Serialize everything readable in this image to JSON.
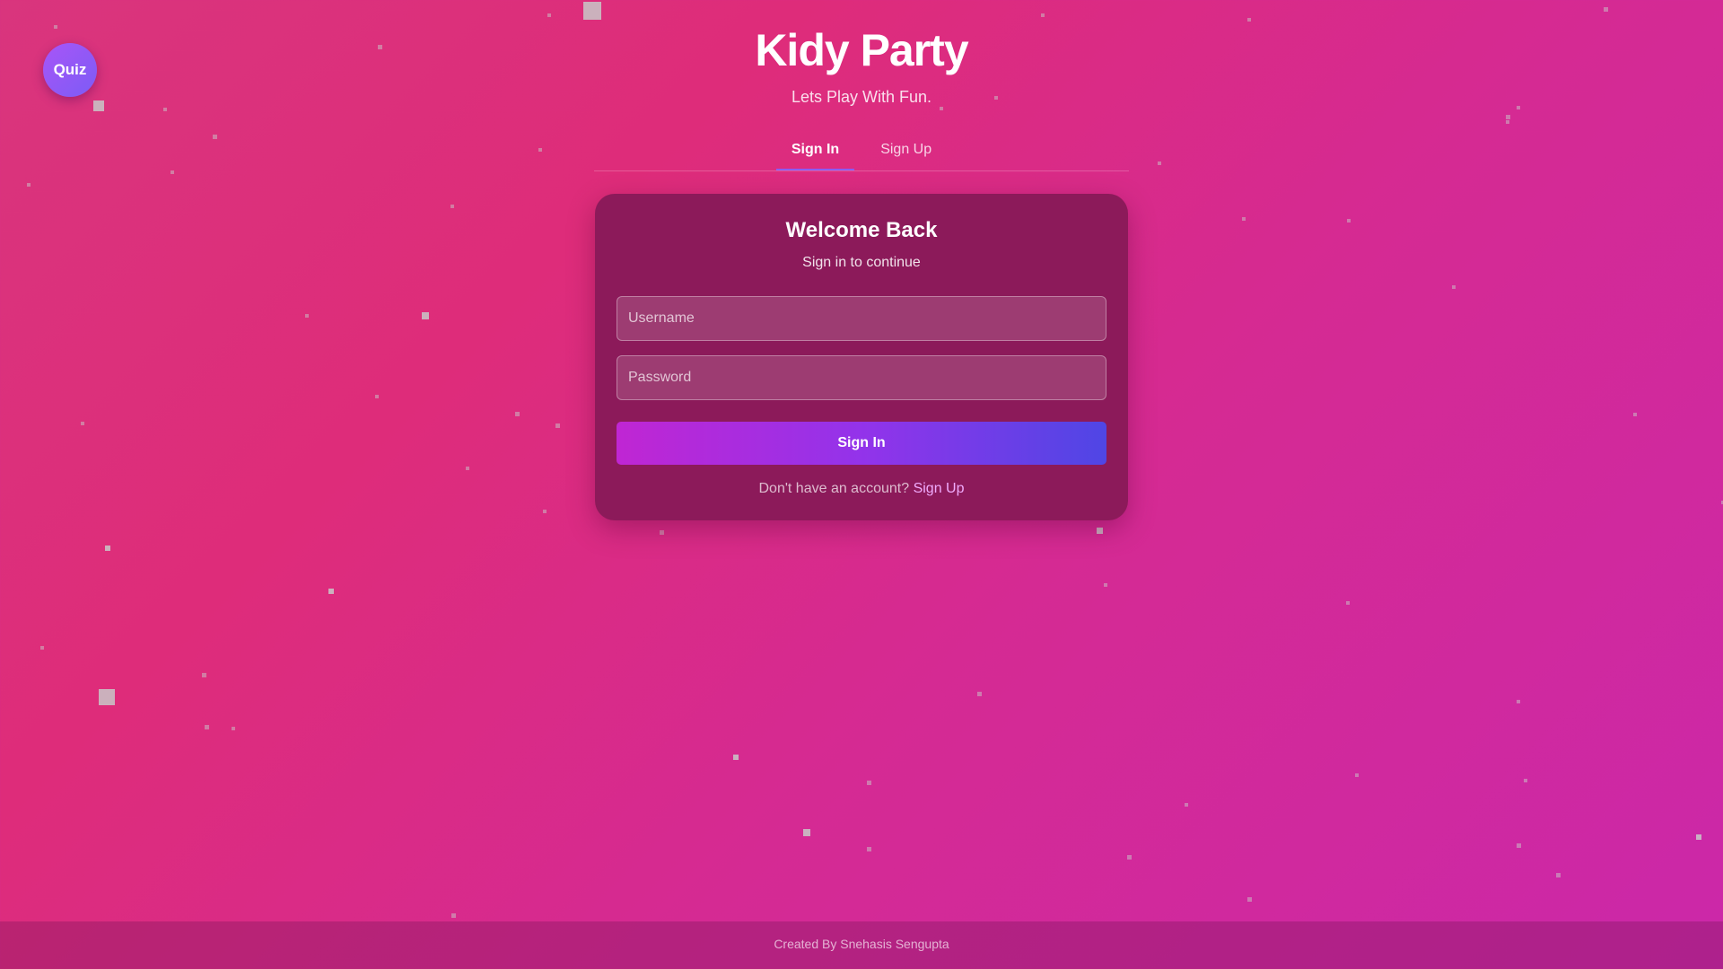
{
  "quiz_button": {
    "label": "Quiz"
  },
  "header": {
    "title": "Kidy Party",
    "subtitle": "Lets Play With Fun."
  },
  "tabs": [
    {
      "label": "Sign In",
      "active": true
    },
    {
      "label": "Sign Up",
      "active": false
    }
  ],
  "form": {
    "title": "Welcome Back",
    "subtitle": "Sign in to continue",
    "username_placeholder": "Username",
    "password_placeholder": "Password",
    "username_value": "",
    "password_value": "",
    "submit_label": "Sign In",
    "switch_prompt": "Don't have an account?",
    "switch_link": "Sign Up"
  },
  "footer": {
    "credit": "Created By Snehasis Sengupta"
  },
  "colors": {
    "background_start": "#d9357d",
    "background_end": "#cb28a9",
    "card": "#8c1a5a",
    "button_start": "#c026d3",
    "button_end": "#4f46e5",
    "quiz_button": "#8b5cf6",
    "link": "#f0abfc"
  }
}
